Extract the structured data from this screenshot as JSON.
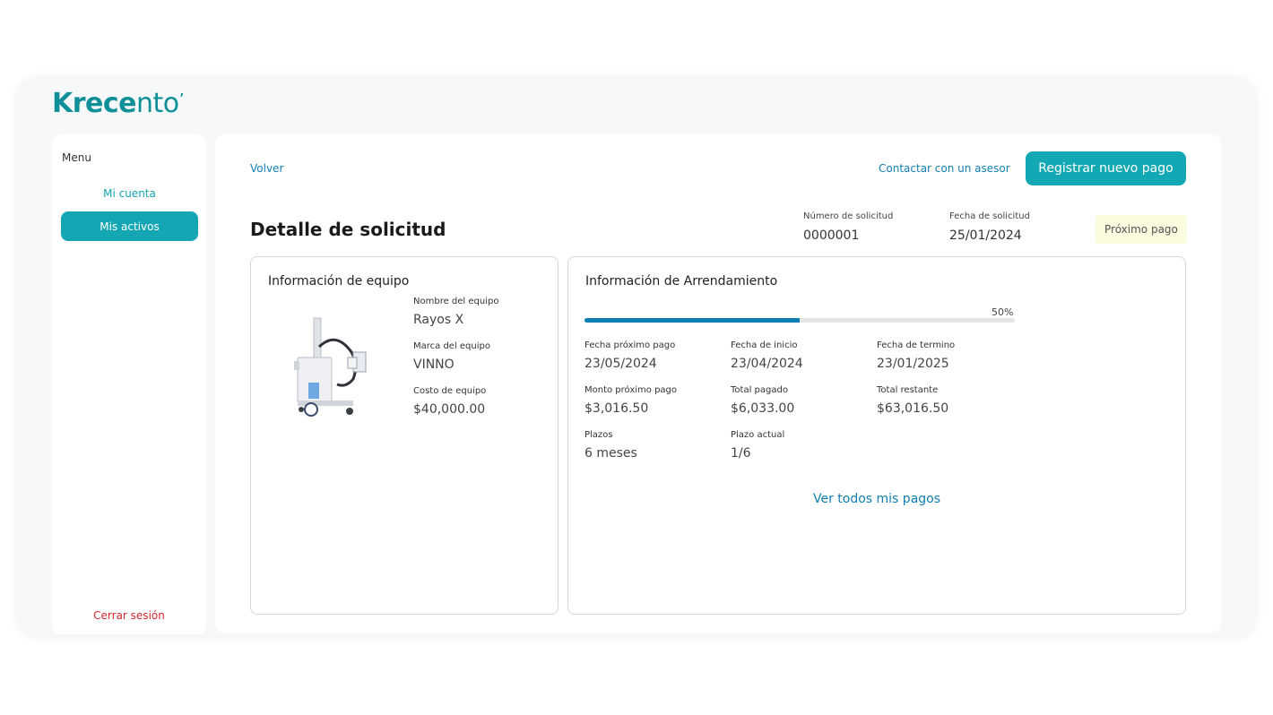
{
  "brand": {
    "bold": "Krece",
    "thin": "nto"
  },
  "sidebar": {
    "menu_label": "Menu",
    "items": [
      {
        "label": "Mi cuenta"
      },
      {
        "label": "Mis activos"
      }
    ],
    "logout": "Cerrar sesión"
  },
  "header": {
    "back": "Volver",
    "contact": "Contactar con un asesor",
    "register": "Registrar nuevo pago"
  },
  "page": {
    "title": "Detalle de solicitud",
    "request_number_label": "Número de solicitud",
    "request_number": "0000001",
    "request_date_label": "Fecha de solicitud",
    "request_date": "25/01/2024",
    "badge": "Próximo pago"
  },
  "equipment": {
    "title": "Información de equipo",
    "fields": [
      {
        "label": "Nombre del equipo",
        "value": "Rayos X"
      },
      {
        "label": "Marca del equipo",
        "value": "VINNO"
      },
      {
        "label": "Costo de equipo",
        "value": "$40,000.00"
      }
    ]
  },
  "lease": {
    "title": "Información de Arrendamiento",
    "progress_label": "50%",
    "progress": 0.5,
    "fields": [
      {
        "label": "Fecha próximo pago",
        "value": "23/05/2024"
      },
      {
        "label": "Fecha de inicio",
        "value": "23/04/2024"
      },
      {
        "label": "Fecha de termino",
        "value": "23/01/2025"
      },
      {
        "label": "Monto próximo pago",
        "value": "$3,016.50"
      },
      {
        "label": "Total pagado",
        "value": "$6,033.00"
      },
      {
        "label": "Total restante",
        "value": "$63,016.50"
      },
      {
        "label": "Plazos",
        "value": "6 meses"
      },
      {
        "label": "Plazo actual",
        "value": "1/6"
      }
    ],
    "all_payments": "Ver todos mis pagos"
  },
  "colors": {
    "accent": "#12a9b5",
    "link": "#0f7fb3",
    "danger": "#d2282e",
    "badge_bg": "#fafbdf"
  }
}
